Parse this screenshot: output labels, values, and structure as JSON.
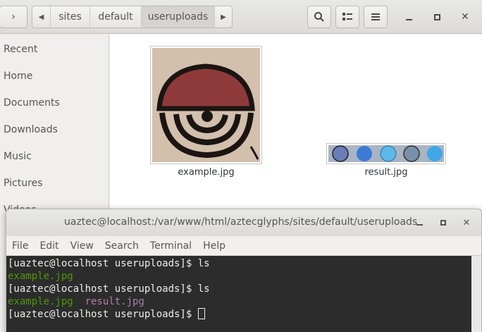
{
  "filemanager": {
    "nav": {
      "back": "‹",
      "forward": "›"
    },
    "breadcrumbs": [
      "sites",
      "default",
      "useruploads"
    ],
    "sidebar": [
      "Recent",
      "Home",
      "Documents",
      "Downloads",
      "Music",
      "Pictures",
      "Videos"
    ],
    "files": [
      {
        "name": "example.jpg"
      },
      {
        "name": "result.jpg"
      }
    ],
    "icons": {
      "search": "search-icon",
      "view": "list-view-icon",
      "menu": "hamburger-menu-icon"
    }
  },
  "terminal": {
    "title": "uaztec@localhost:/var/www/html/aztecglyphs/sites/default/useruploads",
    "menu": [
      "File",
      "Edit",
      "View",
      "Search",
      "Terminal",
      "Help"
    ],
    "lines": [
      {
        "prompt": "[uaztec@localhost useruploads]$ ",
        "cmd": "ls"
      },
      {
        "out1": "example.jpg"
      },
      {
        "prompt": "[uaztec@localhost useruploads]$ ",
        "cmd": "ls"
      },
      {
        "out1": "example.jpg",
        "out2": "result.jpg"
      },
      {
        "prompt": "[uaztec@localhost useruploads]$ ",
        "cmd": ""
      }
    ]
  },
  "colors": {
    "terminal_bg": "#2c2c2c",
    "green_file": "#4e9a06",
    "magenta_file": "#ad7fa8"
  }
}
